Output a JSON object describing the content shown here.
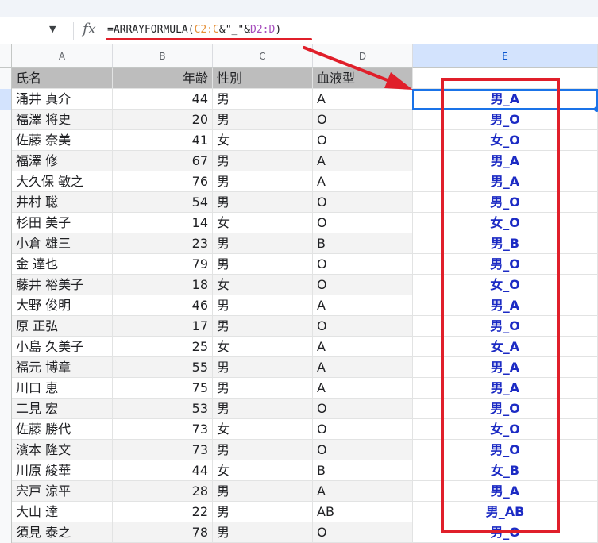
{
  "formula_bar": {
    "fx_label": "fx",
    "formula_prefix": "=ARRAYFORMULA(",
    "formula_ref1": "C2:C",
    "formula_mid": "&\"_\"&",
    "formula_ref2": "D2:D",
    "formula_suffix": ")"
  },
  "columns": [
    "A",
    "B",
    "C",
    "D",
    "E"
  ],
  "selected_column": "E",
  "header_row": {
    "name": "氏名",
    "age": "年齢",
    "gender": "性別",
    "blood": "血液型",
    "result": ""
  },
  "rows": [
    {
      "name": "涌井 真介",
      "age": "44",
      "gender": "男",
      "blood": "A",
      "result": "男_A"
    },
    {
      "name": "福澤 将史",
      "age": "20",
      "gender": "男",
      "blood": "O",
      "result": "男_O"
    },
    {
      "name": "佐藤 奈美",
      "age": "41",
      "gender": "女",
      "blood": "O",
      "result": "女_O"
    },
    {
      "name": "福澤 修",
      "age": "67",
      "gender": "男",
      "blood": "A",
      "result": "男_A"
    },
    {
      "name": "大久保 敏之",
      "age": "76",
      "gender": "男",
      "blood": "A",
      "result": "男_A"
    },
    {
      "name": "井村 聡",
      "age": "54",
      "gender": "男",
      "blood": "O",
      "result": "男_O"
    },
    {
      "name": "杉田 美子",
      "age": "14",
      "gender": "女",
      "blood": "O",
      "result": "女_O"
    },
    {
      "name": "小倉 雄三",
      "age": "23",
      "gender": "男",
      "blood": "B",
      "result": "男_B"
    },
    {
      "name": "金 達也",
      "age": "79",
      "gender": "男",
      "blood": "O",
      "result": "男_O"
    },
    {
      "name": "藤井 裕美子",
      "age": "18",
      "gender": "女",
      "blood": "O",
      "result": "女_O"
    },
    {
      "name": "大野 俊明",
      "age": "46",
      "gender": "男",
      "blood": "A",
      "result": "男_A"
    },
    {
      "name": "原 正弘",
      "age": "17",
      "gender": "男",
      "blood": "O",
      "result": "男_O"
    },
    {
      "name": "小島 久美子",
      "age": "25",
      "gender": "女",
      "blood": "A",
      "result": "女_A"
    },
    {
      "name": "福元 博章",
      "age": "55",
      "gender": "男",
      "blood": "A",
      "result": "男_A"
    },
    {
      "name": "川口 恵",
      "age": "75",
      "gender": "男",
      "blood": "A",
      "result": "男_A"
    },
    {
      "name": "二見 宏",
      "age": "53",
      "gender": "男",
      "blood": "O",
      "result": "男_O"
    },
    {
      "name": "佐藤 勝代",
      "age": "73",
      "gender": "女",
      "blood": "O",
      "result": "女_O"
    },
    {
      "name": "濱本 隆文",
      "age": "73",
      "gender": "男",
      "blood": "O",
      "result": "男_O"
    },
    {
      "name": "川原 綾華",
      "age": "44",
      "gender": "女",
      "blood": "B",
      "result": "女_B"
    },
    {
      "name": "宍戸 涼平",
      "age": "28",
      "gender": "男",
      "blood": "A",
      "result": "男_A"
    },
    {
      "name": "大山 達",
      "age": "22",
      "gender": "男",
      "blood": "AB",
      "result": "男_AB"
    },
    {
      "name": "須見 泰之",
      "age": "78",
      "gender": "男",
      "blood": "O",
      "result": "男_O"
    }
  ],
  "colors": {
    "annotation_red": "#e01f2a",
    "result_blue": "#1c2bc4",
    "selection_blue": "#1a73e8"
  }
}
